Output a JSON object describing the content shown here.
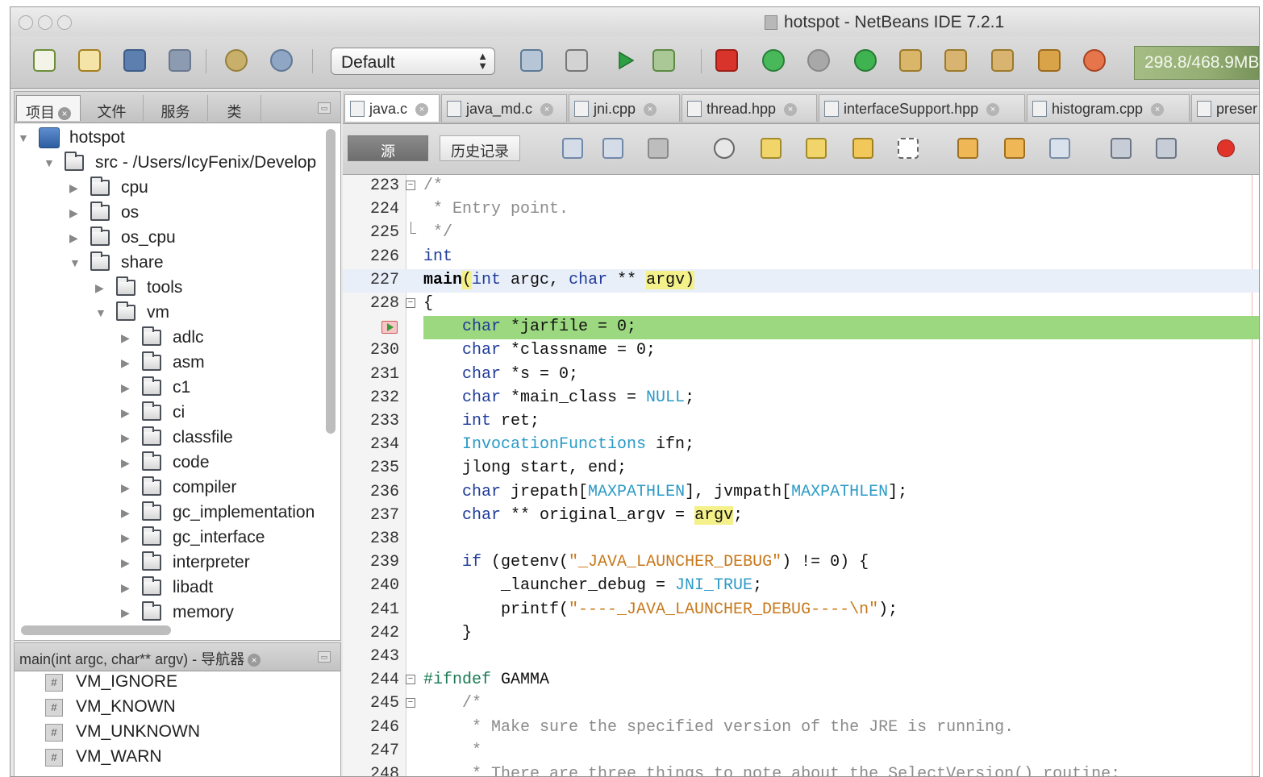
{
  "window": {
    "title": "hotspot - NetBeans IDE 7.2.1"
  },
  "toolbar": {
    "config_value": "Default",
    "memory_text": "298.8/468.9MB",
    "colors": {
      "run": "#2ea043",
      "stop": "#d9342b"
    }
  },
  "project_panel": {
    "tabs": [
      {
        "label": "项目",
        "active": true
      },
      {
        "label": "文件"
      },
      {
        "label": "服务"
      },
      {
        "label": "类"
      }
    ],
    "tree": [
      {
        "label": "hotspot",
        "depth": 0,
        "expanded": true,
        "kind": "project"
      },
      {
        "label": "src - /Users/IcyFenix/Develop",
        "depth": 1,
        "expanded": true,
        "kind": "folder"
      },
      {
        "label": "cpu",
        "depth": 2,
        "expanded": false,
        "kind": "folder"
      },
      {
        "label": "os",
        "depth": 2,
        "expanded": false,
        "kind": "folder"
      },
      {
        "label": "os_cpu",
        "depth": 2,
        "expanded": false,
        "kind": "folder"
      },
      {
        "label": "share",
        "depth": 2,
        "expanded": true,
        "kind": "folder"
      },
      {
        "label": "tools",
        "depth": 3,
        "expanded": false,
        "kind": "folder"
      },
      {
        "label": "vm",
        "depth": 3,
        "expanded": true,
        "kind": "folder"
      },
      {
        "label": "adlc",
        "depth": 4,
        "expanded": false,
        "kind": "folder"
      },
      {
        "label": "asm",
        "depth": 4,
        "expanded": false,
        "kind": "folder"
      },
      {
        "label": "c1",
        "depth": 4,
        "expanded": false,
        "kind": "folder"
      },
      {
        "label": "ci",
        "depth": 4,
        "expanded": false,
        "kind": "folder"
      },
      {
        "label": "classfile",
        "depth": 4,
        "expanded": false,
        "kind": "folder"
      },
      {
        "label": "code",
        "depth": 4,
        "expanded": false,
        "kind": "folder"
      },
      {
        "label": "compiler",
        "depth": 4,
        "expanded": false,
        "kind": "folder"
      },
      {
        "label": "gc_implementation",
        "depth": 4,
        "expanded": false,
        "kind": "folder"
      },
      {
        "label": "gc_interface",
        "depth": 4,
        "expanded": false,
        "kind": "folder"
      },
      {
        "label": "interpreter",
        "depth": 4,
        "expanded": false,
        "kind": "folder"
      },
      {
        "label": "libadt",
        "depth": 4,
        "expanded": false,
        "kind": "folder"
      },
      {
        "label": "memory",
        "depth": 4,
        "expanded": false,
        "kind": "folder"
      }
    ]
  },
  "navigator": {
    "title": "main(int argc, char** argv) - 导航器",
    "items": [
      "VM_IGNORE",
      "VM_KNOWN",
      "VM_UNKNOWN",
      "VM_WARN"
    ]
  },
  "editor": {
    "tabs": [
      {
        "label": "java.c",
        "active": true
      },
      {
        "label": "java_md.c"
      },
      {
        "label": "jni.cpp"
      },
      {
        "label": "thread.hpp"
      },
      {
        "label": "interfaceSupport.hpp"
      },
      {
        "label": "histogram.cpp"
      },
      {
        "label": "preser"
      }
    ],
    "view_buttons": {
      "source": "源",
      "history": "历史记录"
    },
    "lines": [
      {
        "n": "223",
        "fold": "open",
        "indent": 0,
        "tokens": [
          [
            "cm",
            "/*"
          ]
        ]
      },
      {
        "n": "224",
        "indent": 0,
        "tokens": [
          [
            "cm",
            " * Entry point."
          ]
        ]
      },
      {
        "n": "225",
        "fold": "end",
        "indent": 0,
        "tokens": [
          [
            "cm",
            " */"
          ]
        ]
      },
      {
        "n": "226",
        "indent": 0,
        "tokens": [
          [
            "kw",
            "int"
          ]
        ]
      },
      {
        "n": "227",
        "highlight": true,
        "indent": 0,
        "tokens": [
          [
            "bd",
            "main"
          ],
          [
            "yl",
            "("
          ],
          [
            "kw",
            "int"
          ],
          [
            "",
            " argc, "
          ],
          [
            "kw",
            "char"
          ],
          [
            "",
            " ** "
          ],
          [
            "yl",
            "argv)"
          ]
        ]
      },
      {
        "n": "228",
        "fold": "open",
        "indent": 0,
        "tokens": [
          [
            "",
            "{"
          ]
        ]
      },
      {
        "n": "",
        "breakpoint": true,
        "indent": 4,
        "tokens": [
          [
            "kw",
            "char"
          ],
          [
            "",
            " *jarfile = 0;"
          ]
        ]
      },
      {
        "n": "230",
        "indent": 4,
        "tokens": [
          [
            "kw",
            "char"
          ],
          [
            "",
            " *classname = 0;"
          ]
        ]
      },
      {
        "n": "231",
        "indent": 4,
        "tokens": [
          [
            "kw",
            "char"
          ],
          [
            "",
            " *s = 0;"
          ]
        ]
      },
      {
        "n": "232",
        "indent": 4,
        "tokens": [
          [
            "kw",
            "char"
          ],
          [
            "",
            " *main_class = "
          ],
          [
            "mc",
            "NULL"
          ],
          [
            "",
            ";"
          ]
        ]
      },
      {
        "n": "233",
        "indent": 4,
        "tokens": [
          [
            "kw",
            "int"
          ],
          [
            "",
            " ret;"
          ]
        ]
      },
      {
        "n": "234",
        "indent": 4,
        "tokens": [
          [
            "mc",
            "InvocationFunctions"
          ],
          [
            "",
            " ifn;"
          ]
        ]
      },
      {
        "n": "235",
        "indent": 4,
        "tokens": [
          [
            "",
            "jlong start, end;"
          ]
        ]
      },
      {
        "n": "236",
        "indent": 4,
        "tokens": [
          [
            "kw",
            "char"
          ],
          [
            "",
            " jrepath["
          ],
          [
            "mc",
            "MAXPATHLEN"
          ],
          [
            "",
            "], jvmpath["
          ],
          [
            "mc",
            "MAXPATHLEN"
          ],
          [
            "",
            "];"
          ]
        ]
      },
      {
        "n": "237",
        "indent": 4,
        "tokens": [
          [
            "kw",
            "char"
          ],
          [
            "",
            " ** original_argv = "
          ],
          [
            "yl",
            "argv"
          ],
          [
            "",
            ";"
          ]
        ]
      },
      {
        "n": "238",
        "indent": 0,
        "tokens": []
      },
      {
        "n": "239",
        "indent": 4,
        "tokens": [
          [
            "kw",
            "if"
          ],
          [
            "",
            " (getenv("
          ],
          [
            "st",
            "\"_JAVA_LAUNCHER_DEBUG\""
          ],
          [
            "",
            ") != 0) {"
          ]
        ]
      },
      {
        "n": "240",
        "indent": 8,
        "tokens": [
          [
            "",
            "_launcher_debug = "
          ],
          [
            "mc",
            "JNI_TRUE"
          ],
          [
            "",
            ";"
          ]
        ]
      },
      {
        "n": "241",
        "indent": 8,
        "tokens": [
          [
            "",
            "printf("
          ],
          [
            "st",
            "\"----_JAVA_LAUNCHER_DEBUG----\\n\""
          ],
          [
            "",
            ");"
          ]
        ]
      },
      {
        "n": "242",
        "indent": 4,
        "tokens": [
          [
            "",
            "}"
          ]
        ]
      },
      {
        "n": "243",
        "indent": 0,
        "tokens": []
      },
      {
        "n": "244",
        "fold": "open",
        "indent": 0,
        "tokens": [
          [
            "pp",
            "#ifndef"
          ],
          [
            "",
            " GAMMA"
          ]
        ]
      },
      {
        "n": "245",
        "fold": "open",
        "indent": 4,
        "tokens": [
          [
            "cm",
            "/*"
          ]
        ]
      },
      {
        "n": "246",
        "indent": 4,
        "tokens": [
          [
            "cm",
            " * Make sure the specified version of the JRE is running."
          ]
        ]
      },
      {
        "n": "247",
        "indent": 4,
        "tokens": [
          [
            "cm",
            " *"
          ]
        ]
      },
      {
        "n": "248",
        "indent": 4,
        "tokens": [
          [
            "cm",
            " * There are three things to note about the SelectVersion() routine:"
          ]
        ]
      }
    ]
  }
}
